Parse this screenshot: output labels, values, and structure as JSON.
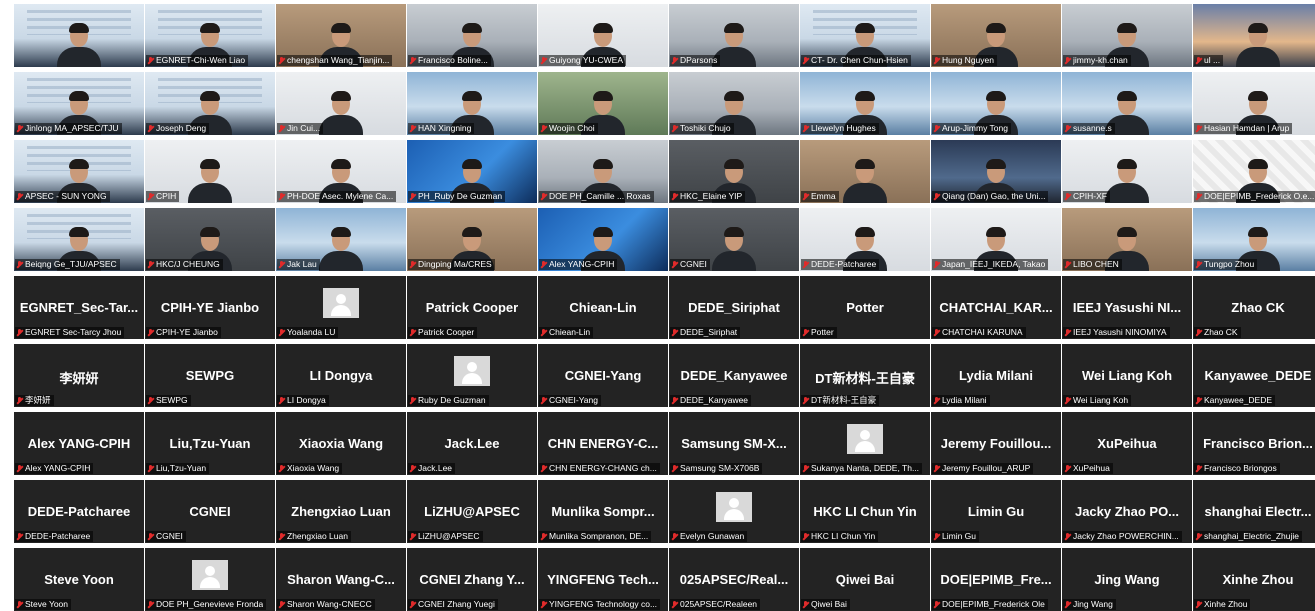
{
  "gallery": {
    "tiles": [
      {
        "display": "",
        "label": "",
        "scene": "slide"
      },
      {
        "display": "",
        "label": "EGNRET-Chi-Wen Liao",
        "scene": "slide"
      },
      {
        "display": "",
        "label": "chengshan Wang_Tianjin...",
        "scene": "warm"
      },
      {
        "display": "",
        "label": "Francisco Boline...",
        "scene": "office"
      },
      {
        "display": "",
        "label": "Guiyong YU-CWEA",
        "scene": "light"
      },
      {
        "display": "",
        "label": "DParsons",
        "scene": "office"
      },
      {
        "display": "",
        "label": "CT- Dr. Chen Chun-Hsien",
        "scene": "slide"
      },
      {
        "display": "",
        "label": "Hung Nguyen",
        "scene": "warm"
      },
      {
        "display": "",
        "label": "jimmy-kh.chan",
        "scene": "office"
      },
      {
        "display": "",
        "label": "ul ...",
        "scene": "sunset"
      },
      {
        "display": "",
        "label": "Jinlong MA_APSEC/TJU",
        "scene": "slide"
      },
      {
        "display": "",
        "label": "Joseph Deng",
        "scene": "slide"
      },
      {
        "display": "",
        "label": "Jin Cui...",
        "scene": "light"
      },
      {
        "display": "",
        "label": "HAN Xingning",
        "scene": "sky"
      },
      {
        "display": "",
        "label": "Woojin Choi",
        "scene": "green"
      },
      {
        "display": "",
        "label": "Toshiki Chujo",
        "scene": "office"
      },
      {
        "display": "",
        "label": "Llewelyn Hughes",
        "scene": "sky"
      },
      {
        "display": "",
        "label": "Arup-Jimmy Tong",
        "scene": "sky"
      },
      {
        "display": "",
        "label": "susanne.s",
        "scene": "sky"
      },
      {
        "display": "",
        "label": "Hasian Hamdan | Arup",
        "scene": "light"
      },
      {
        "display": "",
        "label": "APSEC - SUN YONG",
        "scene": "slide"
      },
      {
        "display": "",
        "label": "CPIH",
        "scene": "light"
      },
      {
        "display": "",
        "label": "PH-DOE Asec. Mylene Ca...",
        "scene": "light"
      },
      {
        "display": "",
        "label": "PH_Ruby De Guzman",
        "scene": "blue"
      },
      {
        "display": "",
        "label": "DOE PH_Camille ... Roxas",
        "scene": "office"
      },
      {
        "display": "",
        "label": "HKC_Elaine YIP",
        "scene": "dark"
      },
      {
        "display": "",
        "label": "Emma",
        "scene": "warm"
      },
      {
        "display": "",
        "label": "Qiang (Dan) Gao, the Uni...",
        "scene": "city"
      },
      {
        "display": "",
        "label": "CPIH-XF",
        "scene": "light"
      },
      {
        "display": "",
        "label": "DOE|EPIMB_Frederick O.e...",
        "scene": "pattern"
      },
      {
        "display": "",
        "label": "Beiqng Ge_TJU/APSEC",
        "scene": "slide"
      },
      {
        "display": "",
        "label": "HKC/J CHEUNG",
        "scene": "dark"
      },
      {
        "display": "",
        "label": "Jak Lau",
        "scene": "sky"
      },
      {
        "display": "",
        "label": "Dingping Ma/CRES",
        "scene": "warm"
      },
      {
        "display": "",
        "label": "Alex YANG-CPIH",
        "scene": "blue"
      },
      {
        "display": "",
        "label": "CGNEI",
        "scene": "dark"
      },
      {
        "display": "",
        "label": "DEDE-Patcharee",
        "scene": "light"
      },
      {
        "display": "",
        "label": "Japan_IEEJ_IKEDA, Takao",
        "scene": "light"
      },
      {
        "display": "",
        "label": "LIBO CHEN",
        "scene": "warm"
      },
      {
        "display": "",
        "label": "Tungpo Zhou",
        "scene": "sky"
      },
      {
        "display": "EGNRET_Sec-Tar...",
        "label": "EGNRET Sec-Tarcy Jhou"
      },
      {
        "display": "CPIH-YE Jianbo",
        "label": "CPIH-YE Jianbo"
      },
      {
        "display": "",
        "label": "Yoalanda LU",
        "avatar": true
      },
      {
        "display": "Patrick Cooper",
        "label": "Patrick Cooper"
      },
      {
        "display": "Chiean-Lin",
        "label": "Chiean-Lin"
      },
      {
        "display": "DEDE_Siriphat",
        "label": "DEDE_Siriphat"
      },
      {
        "display": "Potter",
        "label": "Potter"
      },
      {
        "display": "CHATCHAI_KAR...",
        "label": "CHATCHAI KARUNA"
      },
      {
        "display": "IEEJ Yasushi NI...",
        "label": "IEEJ Yasushi NINOMIYA"
      },
      {
        "display": "Zhao CK",
        "label": "Zhao CK"
      },
      {
        "display": "李妍妍",
        "label": "李妍妍"
      },
      {
        "display": "SEWPG",
        "label": "SEWPG"
      },
      {
        "display": "LI Dongya",
        "label": "LI Dongya"
      },
      {
        "display": "",
        "label": "Ruby De Guzman",
        "avatar": true
      },
      {
        "display": "CGNEI-Yang",
        "label": "CGNEI-Yang"
      },
      {
        "display": "DEDE_Kanyawee",
        "label": "DEDE_Kanyawee"
      },
      {
        "display": "DT新材料-王自豪",
        "label": "DT新材料-王自豪"
      },
      {
        "display": "Lydia Milani",
        "label": "Lydia Milani"
      },
      {
        "display": "Wei Liang Koh",
        "label": "Wei Liang Koh"
      },
      {
        "display": "Kanyawee_DEDE",
        "label": "Kanyawee_DEDE"
      },
      {
        "display": "Alex YANG-CPIH",
        "label": "Alex YANG-CPIH"
      },
      {
        "display": "Liu,Tzu-Yuan",
        "label": "Liu,Tzu-Yuan"
      },
      {
        "display": "Xiaoxia Wang",
        "label": "Xiaoxia Wang"
      },
      {
        "display": "Jack.Lee",
        "label": "Jack.Lee"
      },
      {
        "display": "CHN ENERGY-C...",
        "label": "CHN ENERGY-CHANG ch..."
      },
      {
        "display": "Samsung SM-X...",
        "label": "Samsung SM-X706B"
      },
      {
        "display": "",
        "label": "Sukanya Nanta, DEDE, Th...",
        "avatar": true
      },
      {
        "display": "Jeremy Fouillou...",
        "label": "Jeremy Fouillou_ARUP"
      },
      {
        "display": "XuPeihua",
        "label": "XuPeihua"
      },
      {
        "display": "Francisco Brion...",
        "label": "Francisco Briongos"
      },
      {
        "display": "DEDE-Patcharee",
        "label": "DEDE-Patcharee"
      },
      {
        "display": "CGNEI",
        "label": "CGNEI"
      },
      {
        "display": "Zhengxiao Luan",
        "label": "Zhengxiao Luan"
      },
      {
        "display": "LiZHU@APSEC",
        "label": "LiZHU@APSEC"
      },
      {
        "display": "Munlika Sompr...",
        "label": "Munlika Sompranon, DE..."
      },
      {
        "display": "",
        "label": "Evelyn Gunawan",
        "avatar": true
      },
      {
        "display": "HKC LI Chun Yin",
        "label": "HKC LI Chun Yin"
      },
      {
        "display": "Limin Gu",
        "label": "Limin Gu"
      },
      {
        "display": "Jacky Zhao PO...",
        "label": "Jacky Zhao POWERCHIN..."
      },
      {
        "display": "shanghai Electr...",
        "label": "shanghai_Electric_Zhujie"
      },
      {
        "display": "Steve Yoon",
        "label": "Steve Yoon"
      },
      {
        "display": "",
        "label": "DOE PH_Genevieve Fronda",
        "avatar": true
      },
      {
        "display": "Sharon Wang-C...",
        "label": "Sharon Wang-CNECC"
      },
      {
        "display": "CGNEI Zhang Y...",
        "label": "CGNEI Zhang Yuegi"
      },
      {
        "display": "YINGFENG Tech...",
        "label": "YINGFENG Technology co..."
      },
      {
        "display": "025APSEC/Real...",
        "label": "025APSEC/Realeen"
      },
      {
        "display": "Qiwei Bai",
        "label": "Qiwei Bai"
      },
      {
        "display": "DOE|EPIMB_Fre...",
        "label": "DOE|EPIMB_Frederick Ole"
      },
      {
        "display": "Jing Wang",
        "label": "Jing Wang"
      },
      {
        "display": "Xinhe Zhou",
        "label": "Xinhe Zhou"
      }
    ]
  }
}
